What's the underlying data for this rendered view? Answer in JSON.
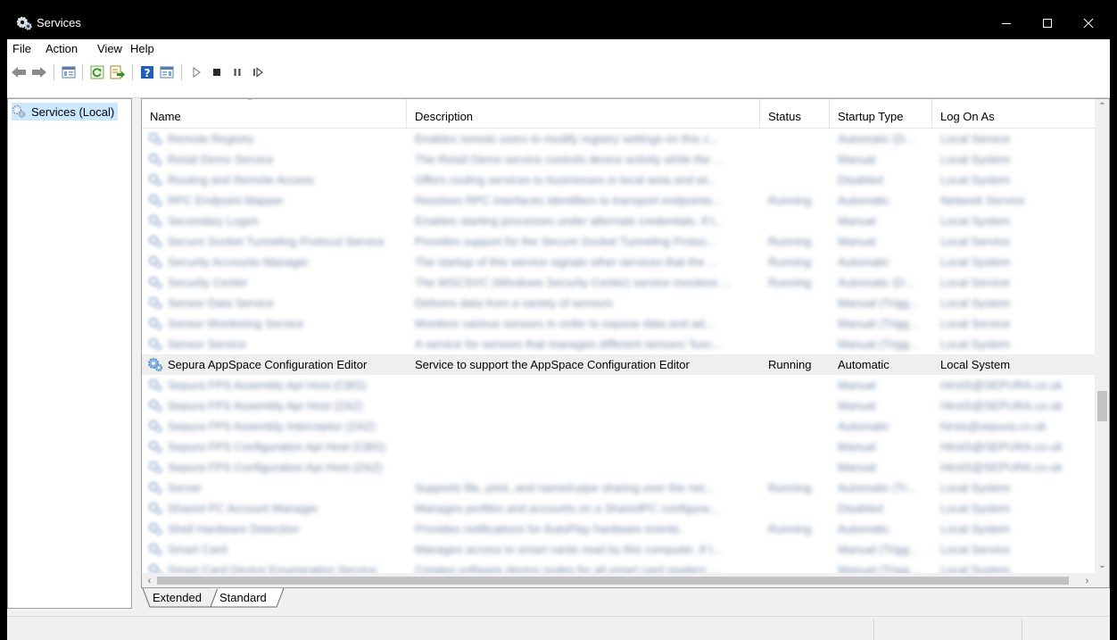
{
  "window": {
    "title": "Services"
  },
  "menu": [
    "File",
    "Action",
    "View",
    "Help"
  ],
  "tree": {
    "root_label": "Services (Local)"
  },
  "columns": [
    "Name",
    "Description",
    "Status",
    "Startup Type",
    "Log On As"
  ],
  "rows": [
    {
      "name": "Remote Registry",
      "description": "Enables remote users to modify registry settings on this c...",
      "status": "",
      "startup": "Automatic (D...",
      "logon": "Local Service",
      "blurred": true
    },
    {
      "name": "Retail Demo Service",
      "description": "The Retail Demo service controls device activity while the ...",
      "status": "",
      "startup": "Manual",
      "logon": "Local System",
      "blurred": true
    },
    {
      "name": "Routing and Remote Access",
      "description": "Offers routing services to businesses in local area and wi...",
      "status": "",
      "startup": "Disabled",
      "logon": "Local System",
      "blurred": true
    },
    {
      "name": "RPC Endpoint Mapper",
      "description": "Resolves RPC interfaces identifiers to transport endpoints...",
      "status": "Running",
      "startup": "Automatic",
      "logon": "Network Service",
      "blurred": true
    },
    {
      "name": "Secondary Logon",
      "description": "Enables starting processes under alternate credentials. If t...",
      "status": "",
      "startup": "Manual",
      "logon": "Local System",
      "blurred": true
    },
    {
      "name": "Secure Socket Tunneling Protocol Service",
      "description": "Provides support for the Secure Socket Tunneling Protoc...",
      "status": "Running",
      "startup": "Manual",
      "logon": "Local Service",
      "blurred": true
    },
    {
      "name": "Security Accounts Manager",
      "description": "The startup of this service signals other services that the ...",
      "status": "Running",
      "startup": "Automatic",
      "logon": "Local System",
      "blurred": true
    },
    {
      "name": "Security Center",
      "description": "The WSCSVC (Windows Security Center) service monitors ...",
      "status": "Running",
      "startup": "Automatic (D...",
      "logon": "Local Service",
      "blurred": true
    },
    {
      "name": "Sensor Data Service",
      "description": "Delivers data from a variety of sensors",
      "status": "",
      "startup": "Manual (Trigg...",
      "logon": "Local System",
      "blurred": true
    },
    {
      "name": "Sensor Monitoring Service",
      "description": "Monitors various sensors in order to expose data and ad...",
      "status": "",
      "startup": "Manual (Trigg...",
      "logon": "Local Service",
      "blurred": true
    },
    {
      "name": "Sensor Service",
      "description": "A service for sensors that manages different sensors' func...",
      "status": "",
      "startup": "Manual (Trigg...",
      "logon": "Local System",
      "blurred": true
    },
    {
      "name": "Sepura AppSpace Configuration Editor",
      "description": "Service to support the AppSpace Configuration Editor",
      "status": "Running",
      "startup": "Automatic",
      "logon": "Local System",
      "blurred": false,
      "selected": true
    },
    {
      "name": "Sepura FPS Assembly Api Host (CBG)",
      "description": "",
      "status": "",
      "startup": "Manual",
      "logon": "HirstS@SEPURA.co.uk",
      "blurred": true
    },
    {
      "name": "Sepura FPS Assembly Api Host (ZAZ)",
      "description": "",
      "status": "",
      "startup": "Manual",
      "logon": "HirstS@SEPURA.co.uk",
      "blurred": true
    },
    {
      "name": "Sepura FPS Assembly Interceptor (ZAZ)",
      "description": "",
      "status": "",
      "startup": "Automatic",
      "logon": "hirsts@sepura.co.uk",
      "blurred": true
    },
    {
      "name": "Sepura FPS Configuration Api Host (CBG)",
      "description": "",
      "status": "",
      "startup": "Manual",
      "logon": "HirstS@SEPURA.co.uk",
      "blurred": true
    },
    {
      "name": "Sepura FPS Configuration Api Host (ZAZ)",
      "description": "",
      "status": "",
      "startup": "Manual",
      "logon": "HirstS@SEPURA.co.uk",
      "blurred": true
    },
    {
      "name": "Server",
      "description": "Supports file, print, and named-pipe sharing over the net...",
      "status": "Running",
      "startup": "Automatic (Tr...",
      "logon": "Local System",
      "blurred": true
    },
    {
      "name": "Shared PC Account Manager",
      "description": "Manages profiles and accounts on a SharedPC configura...",
      "status": "",
      "startup": "Disabled",
      "logon": "Local System",
      "blurred": true
    },
    {
      "name": "Shell Hardware Detection",
      "description": "Provides notifications for AutoPlay hardware events.",
      "status": "Running",
      "startup": "Automatic",
      "logon": "Local System",
      "blurred": true
    },
    {
      "name": "Smart Card",
      "description": "Manages access to smart cards read by this computer. If t...",
      "status": "",
      "startup": "Manual (Trigg...",
      "logon": "Local Service",
      "blurred": true
    },
    {
      "name": "Smart Card Device Enumeration Service",
      "description": "Creates software device nodes for all smart card readers ...",
      "status": "",
      "startup": "Manual (Trigg...",
      "logon": "Local System",
      "blurred": true
    }
  ],
  "tabs": [
    "Extended",
    "Standard"
  ],
  "colors": {
    "selected_row": "#efefef",
    "tree_selected": "#cce8ff",
    "titlebar": "#000000"
  }
}
